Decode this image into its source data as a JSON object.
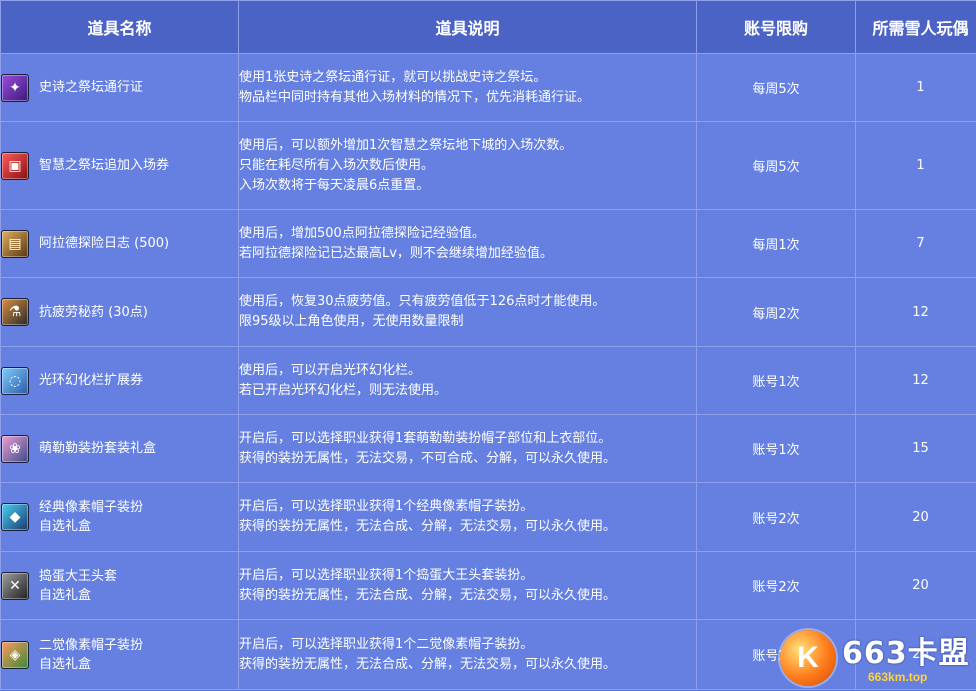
{
  "table": {
    "headers": {
      "name": "道具名称",
      "desc": "道具说明",
      "limit": "账号限购",
      "cost": "所需雪人玩偶"
    },
    "rows": [
      {
        "icon": "epic-altar-pass-icon",
        "name": [
          "史诗之祭坛通行证"
        ],
        "desc": [
          "使用1张史诗之祭坛通行证，就可以挑战史诗之祭坛。",
          "物品栏中同时持有其他入场材料的情况下，优先消耗通行证。"
        ],
        "limit": "每周5次",
        "cost": "1"
      },
      {
        "icon": "wisdom-altar-ticket-icon",
        "name": [
          "智慧之祭坛追加入场券"
        ],
        "desc": [
          "使用后，可以额外增加1次智慧之祭坛地下城的入场次数。",
          "只能在耗尽所有入场次数后使用。",
          "入场次数将于每天凌晨6点重置。"
        ],
        "limit": "每周5次",
        "cost": "1"
      },
      {
        "icon": "adventure-journal-icon",
        "name": [
          "阿拉德探险日志 (500)"
        ],
        "desc": [
          "使用后，增加500点阿拉德探险记经验值。",
          "若阿拉德探险记已达最高Lv，则不会继续增加经验值。"
        ],
        "limit": "每周1次",
        "cost": "7"
      },
      {
        "icon": "fatigue-potion-icon",
        "name": [
          "抗疲劳秘药 (30点)"
        ],
        "desc": [
          "使用后，恢复30点疲劳值。只有疲劳值低于126点时才能使用。",
          "限95级以上角色使用，无使用数量限制"
        ],
        "limit": "每周2次",
        "cost": "12"
      },
      {
        "icon": "aura-slot-icon",
        "name": [
          "光环幻化栏扩展券"
        ],
        "desc": [
          "使用后，可以开启光环幻化栏。",
          "若已开启光环幻化栏，则无法使用。"
        ],
        "limit": "账号1次",
        "cost": "12"
      },
      {
        "icon": "cute-costume-box-icon",
        "name": [
          "萌勒勒装扮套装礼盒"
        ],
        "desc": [
          "开启后，可以选择职业获得1套萌勒勒装扮帽子部位和上衣部位。",
          "获得的装扮无属性，无法交易，不可合成、分解，可以永久使用。"
        ],
        "limit": "账号1次",
        "cost": "15"
      },
      {
        "icon": "pixel-hat-box-icon",
        "name": [
          "经典像素帽子装扮",
          "自选礼盒"
        ],
        "desc": [
          "开启后，可以选择职业获得1个经典像素帽子装扮。",
          "获得的装扮无属性，无法合成、分解，无法交易，可以永久使用。"
        ],
        "limit": "账号2次",
        "cost": "20"
      },
      {
        "icon": "troublemaker-hat-box-icon",
        "name": [
          "捣蛋大王头套",
          "自选礼盒"
        ],
        "desc": [
          "开启后，可以选择职业获得1个捣蛋大王头套装扮。",
          "获得的装扮无属性，无法合成、分解，无法交易，可以永久使用。"
        ],
        "limit": "账号2次",
        "cost": "20"
      },
      {
        "icon": "awakening-pixel-hat-box-icon",
        "name": [
          "二觉像素帽子装扮",
          "自选礼盒"
        ],
        "desc": [
          "开启后，可以选择职业获得1个二觉像素帽子装扮。",
          "获得的装扮无属性，无法合成、分解，无法交易，可以永久使用。"
        ],
        "limit": "账号2次",
        "cost": "20"
      }
    ]
  },
  "watermark": {
    "logo_letter": "K",
    "title": "663卡盟",
    "url": "663km.top"
  }
}
